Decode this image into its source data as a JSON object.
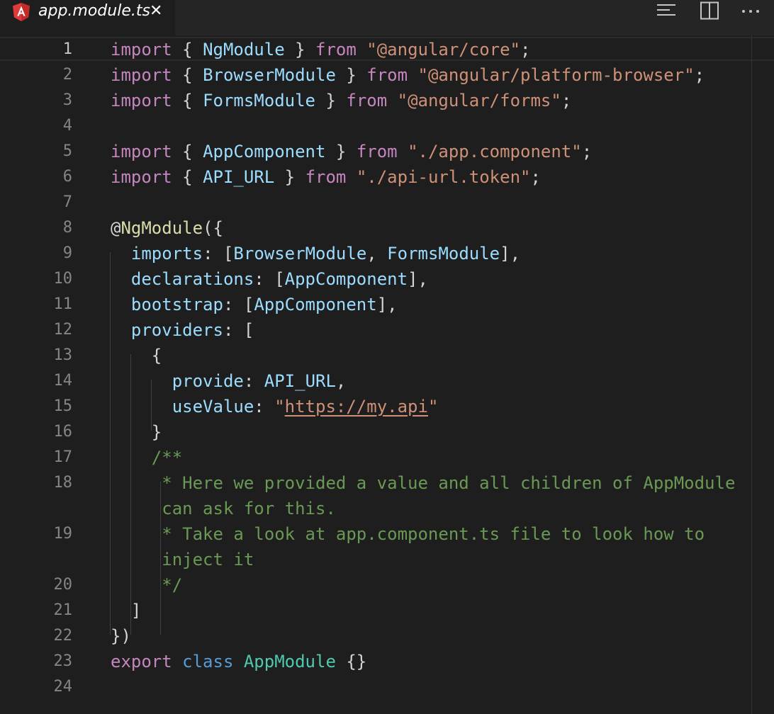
{
  "tab": {
    "title": "app.module.ts",
    "close_glyph": "✕",
    "language_icon": "angular-icon"
  },
  "toolbar": {
    "actions": [
      {
        "name": "outline-icon"
      },
      {
        "name": "split-editor-icon"
      },
      {
        "name": "more-actions-icon"
      }
    ]
  },
  "editor": {
    "active_line": 1,
    "lines": [
      {
        "n": "1",
        "text": "import { NgModule } from \"@angular/core\";"
      },
      {
        "n": "2",
        "text": "import { BrowserModule } from \"@angular/platform-browser\";"
      },
      {
        "n": "3",
        "text": "import { FormsModule } from \"@angular/forms\";"
      },
      {
        "n": "4",
        "text": ""
      },
      {
        "n": "5",
        "text": "import { AppComponent } from \"./app.component\";"
      },
      {
        "n": "6",
        "text": "import { API_URL } from \"./api-url.token\";"
      },
      {
        "n": "7",
        "text": ""
      },
      {
        "n": "8",
        "text": "@NgModule({"
      },
      {
        "n": "9",
        "text": "  imports: [BrowserModule, FormsModule],"
      },
      {
        "n": "10",
        "text": "  declarations: [AppComponent],"
      },
      {
        "n": "11",
        "text": "  bootstrap: [AppComponent],"
      },
      {
        "n": "12",
        "text": "  providers: ["
      },
      {
        "n": "13",
        "text": "    {"
      },
      {
        "n": "14",
        "text": "      provide: API_URL,"
      },
      {
        "n": "15",
        "text": "      useValue: \"https://my.api\""
      },
      {
        "n": "16",
        "text": "    }"
      },
      {
        "n": "17",
        "text": "    /**"
      },
      {
        "n": "18",
        "text": "     * Here we provided a value and all children of AppModule"
      },
      {
        "n": "",
        "text": "     can ask for this."
      },
      {
        "n": "19",
        "text": "     * Take a look at app.component.ts file to look how to"
      },
      {
        "n": "",
        "text": "     inject it"
      },
      {
        "n": "20",
        "text": "     */"
      },
      {
        "n": "21",
        "text": "  ]"
      },
      {
        "n": "22",
        "text": "})"
      },
      {
        "n": "23",
        "text": "export class AppModule {}"
      },
      {
        "n": "24",
        "text": ""
      }
    ]
  },
  "colors": {
    "background": "#1e1e1e",
    "keyword": "#c586c0",
    "storage": "#569cd6",
    "variable": "#9cdcfe",
    "class": "#4ec9b0",
    "string": "#ce9178",
    "decorator": "#dcdcaa",
    "comment": "#6a9955"
  }
}
